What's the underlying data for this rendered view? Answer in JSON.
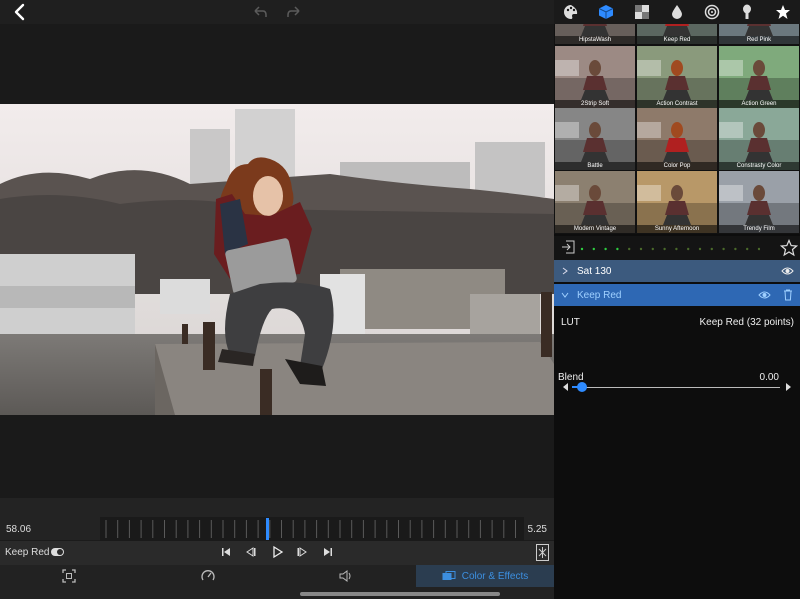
{
  "toolbar": {
    "back": "back",
    "undo": "undo",
    "redo": "redo"
  },
  "timeline": {
    "start_time": "58.06",
    "end_time": "5.25"
  },
  "playback": {
    "clip_name": "Keep Red"
  },
  "bottom_tabs": {
    "color_effects_label": "Color & Effects"
  },
  "panel": {
    "tabs": [
      "palette-icon",
      "lut-cube-icon",
      "grid-icon",
      "drop-icon",
      "spiral-icon",
      "brush-icon",
      "star-icon"
    ],
    "filters": [
      {
        "label": "HipstaWash"
      },
      {
        "label": "Keep Red"
      },
      {
        "label": "Red Pink"
      },
      {
        "label": "2Strip Soft"
      },
      {
        "label": "Action Contrast"
      },
      {
        "label": "Action Green"
      },
      {
        "label": "Battle"
      },
      {
        "label": "Color Pop"
      },
      {
        "label": "Constrasty Color"
      },
      {
        "label": "Modern Vintage"
      },
      {
        "label": "Sunny Afternoon"
      },
      {
        "label": "Trendy Film"
      }
    ],
    "layers": [
      {
        "label": "Sat 130"
      },
      {
        "label": "Keep Red"
      }
    ],
    "lut": {
      "label": "LUT",
      "value": "Keep Red (32 points)"
    },
    "blend": {
      "label": "Blend",
      "value": "0.00",
      "level": 0.0
    }
  },
  "colors": {
    "accent": "#2e8bff",
    "layer_selected": "#2e68b4",
    "layer": "#3c5a7e"
  }
}
